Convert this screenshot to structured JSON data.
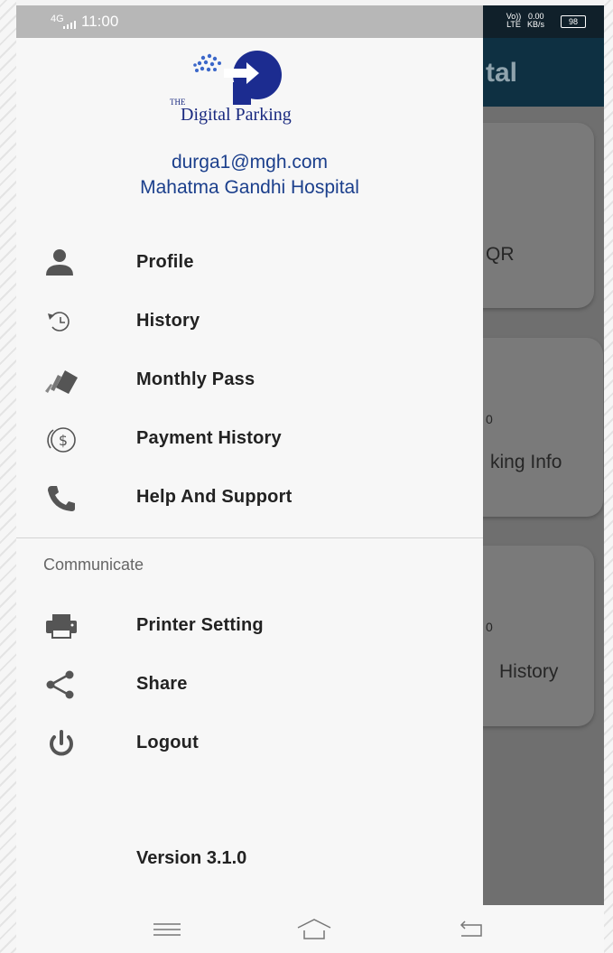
{
  "status_bar": {
    "network": "4G",
    "time": "11:00",
    "volte": "Vo)) LTE",
    "speed": "0.00",
    "speed_unit": "KB/s",
    "battery": "98"
  },
  "background_app": {
    "title_fragment": "tal",
    "cards": [
      {
        "fragment": "QR",
        "mini": ""
      },
      {
        "fragment": "king Info",
        "mini": "0"
      },
      {
        "fragment": "History",
        "mini": "0"
      }
    ]
  },
  "drawer": {
    "logo": {
      "the": "THE",
      "name": "Digital Parking"
    },
    "user": {
      "email": "durga1@mgh.com",
      "organization": "Mahatma Gandhi Hospital"
    },
    "menu": [
      {
        "label": "Profile",
        "icon": "person-icon"
      },
      {
        "label": "History",
        "icon": "history-icon"
      },
      {
        "label": "Monthly Pass",
        "icon": "tickets-icon"
      },
      {
        "label": "Payment History",
        "icon": "payment-history-icon"
      },
      {
        "label": "Help And Support",
        "icon": "phone-icon"
      }
    ],
    "section_title": "Communicate",
    "communicate": [
      {
        "label": "Printer Setting",
        "icon": "printer-icon"
      },
      {
        "label": "Share",
        "icon": "share-icon"
      },
      {
        "label": "Logout",
        "icon": "power-icon"
      }
    ],
    "version": "Version 3.1.0"
  },
  "colors": {
    "brand_blue": "#1b3f8c",
    "appbar": "#0e3042",
    "drawer_bg": "#f7f7f7"
  }
}
